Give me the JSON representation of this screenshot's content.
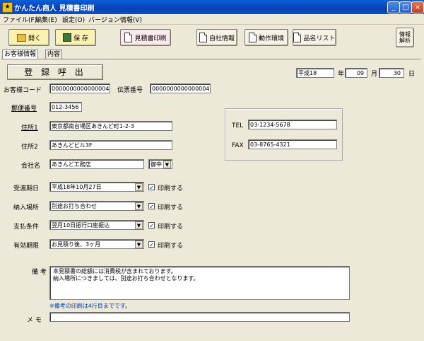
{
  "window": {
    "title": "かんたん商人 見積書印刷",
    "minimize": "_",
    "maximize": "□",
    "close": "×"
  },
  "menu": [
    "ファイル(F)",
    "編集(E)",
    "設定(O)",
    "バージョン情報(V)"
  ],
  "toolbar": {
    "open": "開く",
    "save": "保 存",
    "print": "見積書印刷",
    "company": "自社情報",
    "env": "動作環境",
    "items": "品名リスト",
    "info_l1": "情報",
    "info_l2": "解析"
  },
  "tabs": [
    "お客様情報",
    "内容"
  ],
  "form": {
    "call_button": "登 録 呼 出",
    "era": "平成18",
    "year_label": "年",
    "month": "09",
    "month_label": "月",
    "day": "30",
    "day_label": "日",
    "customer_code_label": "お客様コード",
    "customer_code": "0000000000000004",
    "slip_no_label": "伝票番号",
    "slip_no": "0000000000000004",
    "postal_label": "郵便番号",
    "postal": "012-3456",
    "address1_label": "住所1",
    "address1": "東京都南台場区あきんど町1-2-3",
    "address2_label": "住所2",
    "address2": "あきんどビル3F",
    "company_label": "会社名",
    "company": "あきんど工務店",
    "honorific": "御中",
    "tel_label": "TEL",
    "tel": "03-1234-5678",
    "fax_label": "FAX",
    "fax": "03-8765-4321",
    "delivery_label": "受渡期日",
    "delivery": "平成18年10月27日",
    "place_label": "納入場所",
    "place": "別途お打ち合わせ",
    "payment_label": "支払条件",
    "payment": "翌月10日振行口座振込",
    "validity_label": "有効期限",
    "validity": "お見積り後、3ヶ月",
    "print_label": "印刷する",
    "note_label": "備 考",
    "note_line1": "本見積書の総額には消費税が含まれております。",
    "note_line2": "納入場所につきましては、別途お打ち合わせとなります。",
    "note_hint": "※備考の印刷は4行目までです。",
    "memo_label": "メ モ",
    "memo": ""
  },
  "colors": {
    "titlebar": "#0a50c8",
    "background": "#ece9d8",
    "hint": "#0040c0"
  }
}
